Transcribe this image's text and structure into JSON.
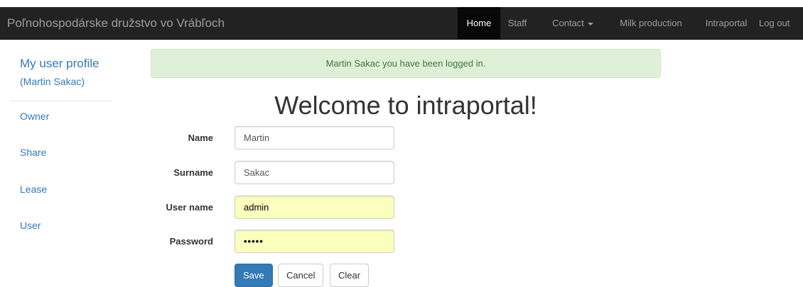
{
  "navbar": {
    "brand": "Poľnohospodárske družstvo vo Vrábľoch",
    "items": [
      {
        "label": "Home"
      },
      {
        "label": "Staff"
      },
      {
        "label": "Contact"
      },
      {
        "label": "Milk production"
      },
      {
        "label": "Intraportal"
      },
      {
        "label": "Log out"
      }
    ],
    "active_item": "Home"
  },
  "sidebar": {
    "title": "My user profile",
    "subtitle": "(Martin Sakac)",
    "links": [
      {
        "label": "Owner"
      },
      {
        "label": "Share"
      },
      {
        "label": "Lease"
      },
      {
        "label": "User"
      }
    ]
  },
  "alert": {
    "message": "Martin Sakac you have been logged in."
  },
  "main": {
    "heading": "Welcome to intraportal!"
  },
  "form": {
    "fields": [
      {
        "label": "Name",
        "value": "Martin"
      },
      {
        "label": "Surname",
        "value": "Sakac"
      },
      {
        "label": "User name",
        "value": "admin"
      },
      {
        "label": "Password",
        "value": "•••••"
      }
    ],
    "buttons": {
      "save": "Save",
      "cancel": "Cancel",
      "clear": "Clear"
    }
  },
  "colors": {
    "navbar_bg": "#222222",
    "link": "#337ab7",
    "alert_bg": "#dff0d8",
    "alert_text": "#3c763d",
    "autofill_bg": "#faffbd",
    "primary_button": "#337ab7"
  }
}
